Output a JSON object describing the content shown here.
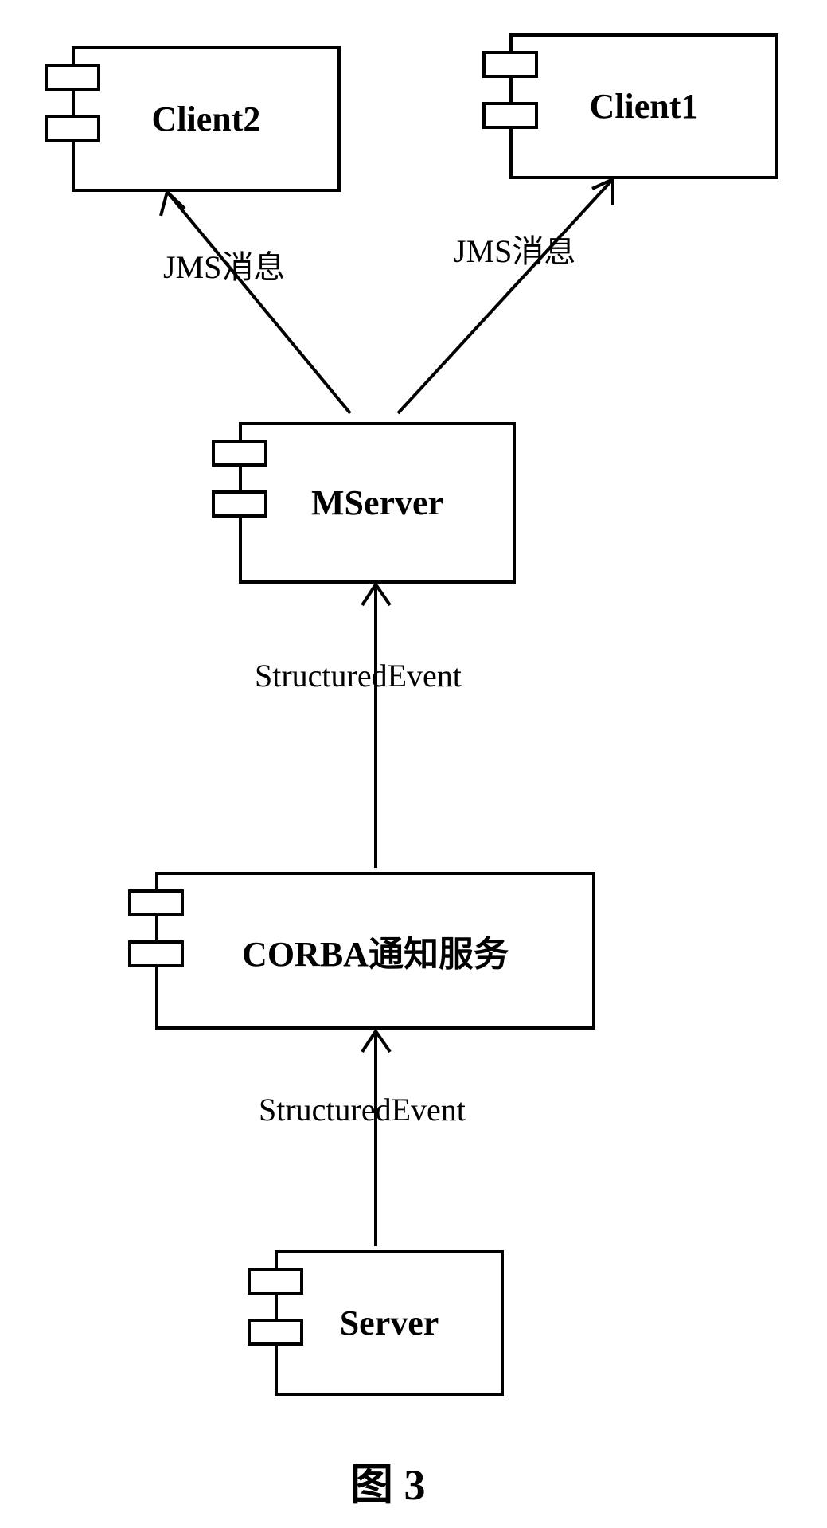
{
  "components": {
    "client1": "Client1",
    "client2": "Client2",
    "mserver": "MServer",
    "corba": "CORBA通知服务",
    "server": "Server"
  },
  "labels": {
    "jms_left": "JMS消息",
    "jms_right": "JMS消息",
    "se_top": "StructuredEvent",
    "se_bottom": "StructuredEvent"
  },
  "caption": "图 3"
}
